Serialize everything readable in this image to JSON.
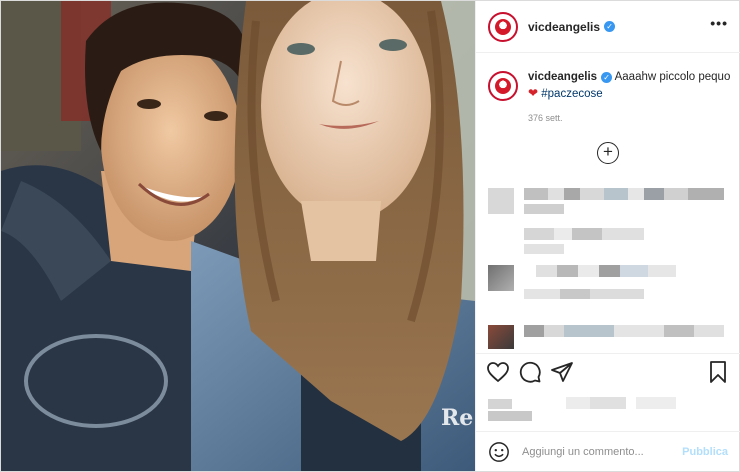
{
  "post": {
    "username": "vicdeangelis",
    "verified_mark": "✓",
    "more_label": "•••",
    "caption": {
      "username": "vicdeangelis",
      "text": "Aaaahw piccolo pequo",
      "heart": "❤",
      "hashtag": "#paczecose",
      "time": "376 sett."
    },
    "load_more_label": "+",
    "comment_placeholder": "Aggiungi un commento...",
    "publish_label": "Pubblica",
    "photo_watermark": "Re"
  },
  "icons": {
    "like": "heart-icon",
    "comment": "comment-icon",
    "share": "paper-plane-icon",
    "save": "bookmark-icon",
    "emoji": "emoji-icon",
    "more": "more-options-icon"
  },
  "colors": {
    "accent_link": "#00376b",
    "publish_disabled": "#b2dffc",
    "verified": "#3897f0",
    "brand_red": "#c8102e"
  }
}
